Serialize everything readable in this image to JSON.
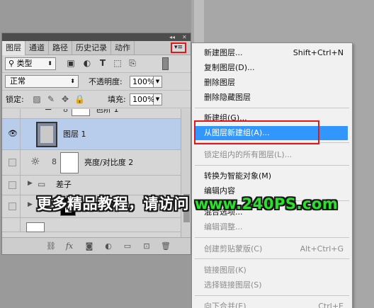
{
  "panel": {
    "tabs": [
      "图层",
      "通道",
      "路径",
      "历史记录",
      "动作"
    ],
    "active_tab": 0,
    "menu_button": "▾≡",
    "filter": {
      "value": "类型",
      "icon": "search-icon"
    },
    "blend_mode": "正常",
    "opacity_label": "不透明度:",
    "opacity_value": "100%",
    "lock_label": "锁定:",
    "fill_label": "填充:",
    "fill_value": "100%",
    "layers": [
      {
        "name": "色阶 1",
        "visible": false,
        "type": "adjustment-mask"
      },
      {
        "name": "图层 1",
        "visible": true,
        "type": "layer",
        "selected": true
      },
      {
        "name": "亮度/对比度 2",
        "visible": false,
        "type": "adjustment"
      },
      {
        "name": "差子",
        "visible": false,
        "type": "group"
      },
      {
        "name": "台器",
        "visible": false,
        "type": "group"
      }
    ]
  },
  "menu": {
    "items": [
      {
        "label": "新建图层...",
        "shortcut": "Shift+Ctrl+N"
      },
      {
        "label": "复制图层(D)..."
      },
      {
        "label": "删除图层"
      },
      {
        "label": "删除隐藏图层"
      },
      {
        "label": "新建组(G)..."
      },
      {
        "label": "从图层新建组(A)...",
        "highlighted": true
      },
      {
        "label": "锁定组内的所有图层(L)...",
        "disabled": true
      },
      {
        "label": "转换为智能对象(M)"
      },
      {
        "label": "编辑内容"
      },
      {
        "label": "混合选项..."
      },
      {
        "label": "编辑调整...",
        "disabled": true
      },
      {
        "label": "创建剪贴蒙版(C)",
        "shortcut": "Alt+Ctrl+G",
        "disabled": true
      },
      {
        "label": "链接图层(K)",
        "disabled": true
      },
      {
        "label": "选择链接图层(S)",
        "disabled": true
      },
      {
        "label": "向下合并(E)",
        "shortcut": "Ctrl+E",
        "disabled": true
      }
    ]
  },
  "watermark": {
    "text": "更多精品教程，请访问",
    "url": "www.240PS.com"
  },
  "colors": {
    "highlight": "#3297fd",
    "selected_layer": "#b8ccec",
    "annotation": "#e01818",
    "watermark_url": "#2be12b"
  }
}
